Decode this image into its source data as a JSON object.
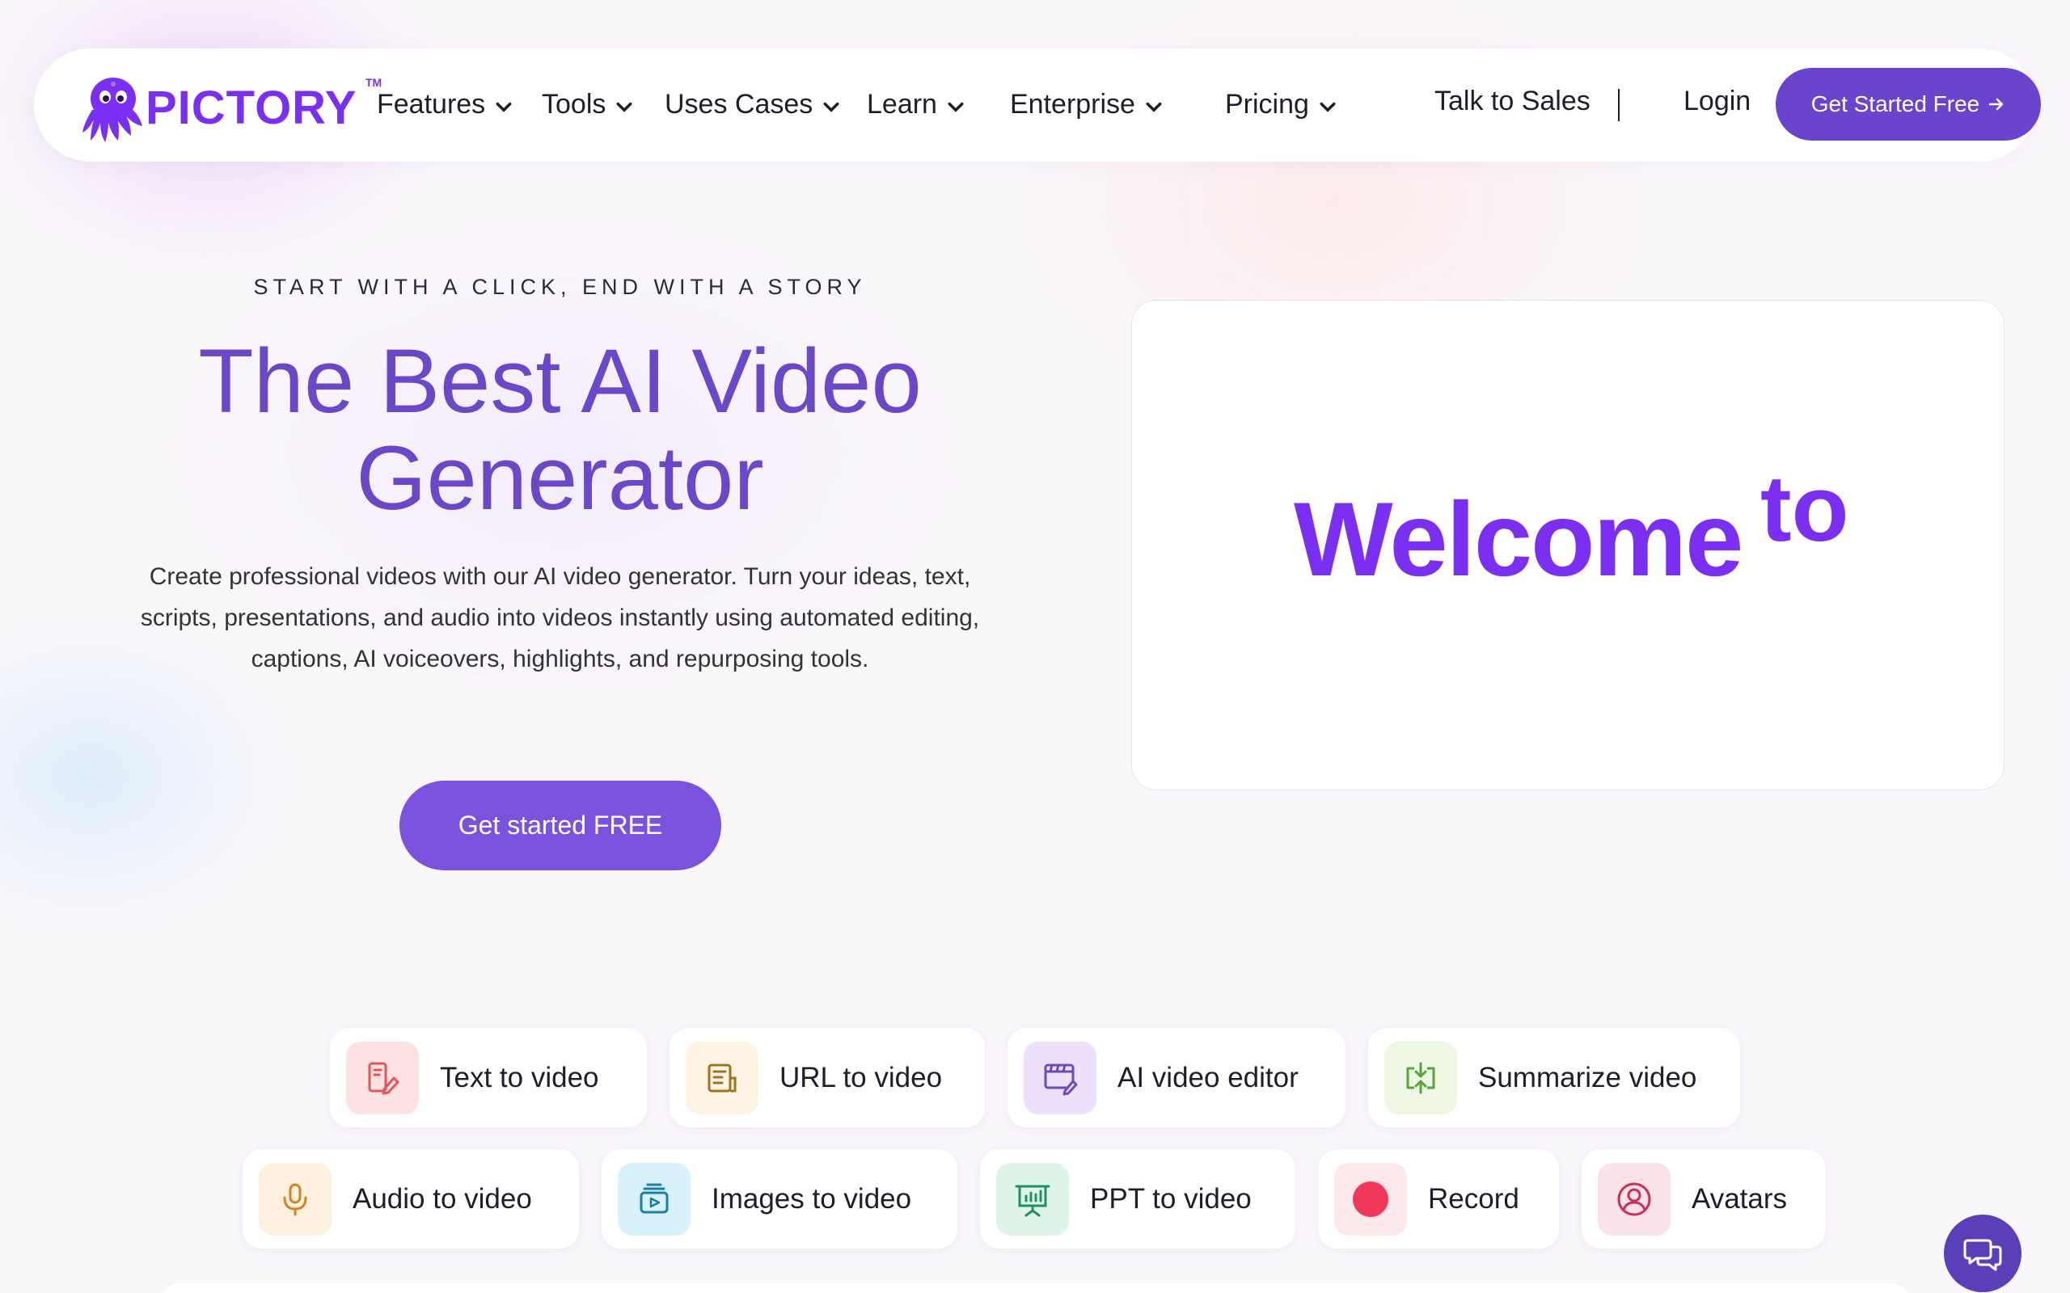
{
  "brand": {
    "name": "PICTORY",
    "tm": "TM",
    "color": "#7b2ff2"
  },
  "nav": {
    "items": [
      "Features",
      "Tools",
      "Uses Cases",
      "Learn",
      "Enterprise",
      "Pricing"
    ],
    "talk_to_sales": "Talk to Sales",
    "login": "Login",
    "cta": "Get Started Free",
    "cta_icon": "arrow-right-icon"
  },
  "hero": {
    "eyebrow": "START WITH A CLICK, END WITH A STORY",
    "title_line1": "The Best AI Video",
    "title_line2": "Generator",
    "description": "Create professional videos with our AI video generator. Turn your ideas, text, scripts, presentations, and audio into videos instantly using automated editing, captions, AI voiceovers, highlights, and repurposing tools.",
    "cta": "Get started FREE"
  },
  "video": {
    "word1": "Welcome",
    "word2": "to"
  },
  "features": [
    {
      "label": "Text to video",
      "icon": "text-edit-icon",
      "bg": "#fde2e2",
      "color": "#e0565c"
    },
    {
      "label": "URL to video",
      "icon": "document-icon",
      "bg": "#fdf4e4",
      "color": "#a07322"
    },
    {
      "label": "AI video editor",
      "icon": "video-editor-icon",
      "bg": "#ece0fb",
      "color": "#6e4bb6"
    },
    {
      "label": "Summarize video",
      "icon": "summarize-icon",
      "bg": "#eef7e3",
      "color": "#58a33b"
    },
    {
      "label": "Audio to video",
      "icon": "microphone-icon",
      "bg": "#fef0de",
      "color": "#d0852a"
    },
    {
      "label": "Images to video",
      "icon": "images-icon",
      "bg": "#d8f2fb",
      "color": "#1a7fa6"
    },
    {
      "label": "PPT to video",
      "icon": "presentation-icon",
      "bg": "#dff5ea",
      "color": "#1f8f60"
    },
    {
      "label": "Record",
      "icon": "record-icon",
      "bg": "#fde9ec",
      "color": "#f0385a"
    },
    {
      "label": "Avatars",
      "icon": "avatar-icon",
      "bg": "#fbe1e8",
      "color": "#c8305a"
    }
  ],
  "chat": {
    "icon": "chat-icon"
  },
  "accent": "#6a44cc"
}
